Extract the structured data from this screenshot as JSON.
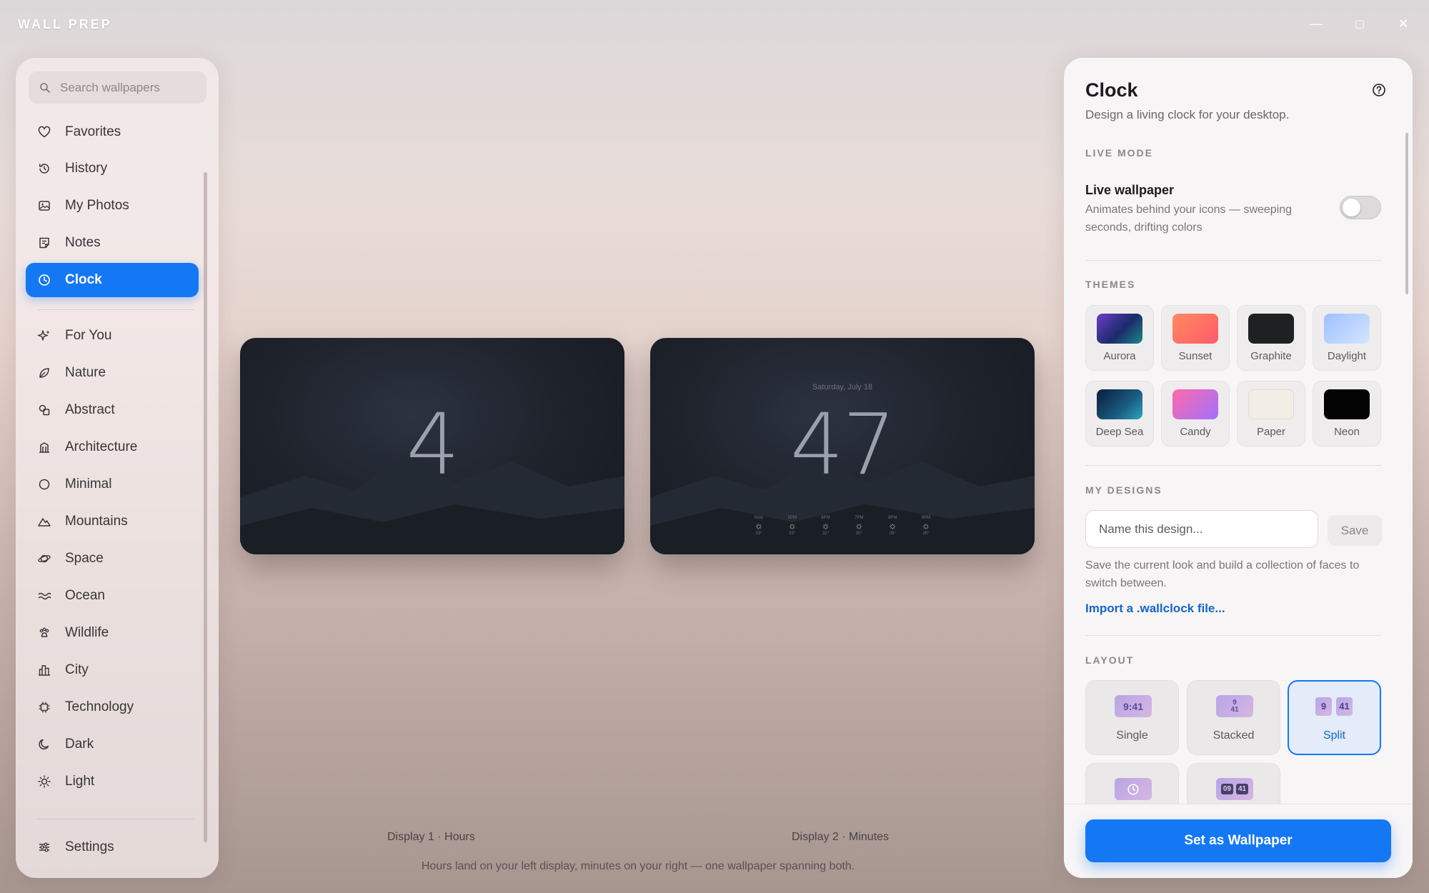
{
  "app": {
    "title": "WALL PREP"
  },
  "window_controls": {
    "minimize": "—",
    "maximize": "▢",
    "close": "✕"
  },
  "sidebar": {
    "search_placeholder": "Search wallpapers",
    "library": [
      {
        "label": "Favorites",
        "icon": "heart-icon"
      },
      {
        "label": "History",
        "icon": "history-icon"
      },
      {
        "label": "My Photos",
        "icon": "photo-icon"
      },
      {
        "label": "Notes",
        "icon": "note-icon"
      },
      {
        "label": "Clock",
        "icon": "clock-icon",
        "active": true
      }
    ],
    "categories": [
      {
        "label": "For You",
        "icon": "sparkle-icon"
      },
      {
        "label": "Nature",
        "icon": "leaf-icon"
      },
      {
        "label": "Abstract",
        "icon": "shapes-icon"
      },
      {
        "label": "Architecture",
        "icon": "building-icon"
      },
      {
        "label": "Minimal",
        "icon": "circle-icon"
      },
      {
        "label": "Mountains",
        "icon": "mountain-icon"
      },
      {
        "label": "Space",
        "icon": "planet-icon"
      },
      {
        "label": "Ocean",
        "icon": "waves-icon"
      },
      {
        "label": "Wildlife",
        "icon": "paw-icon"
      },
      {
        "label": "City",
        "icon": "city-icon"
      },
      {
        "label": "Technology",
        "icon": "chip-icon"
      },
      {
        "label": "Dark",
        "icon": "moon-icon"
      },
      {
        "label": "Light",
        "icon": "sun-icon"
      }
    ],
    "settings_label": "Settings"
  },
  "preview": {
    "display1": {
      "number": "4",
      "label": "Display 1 · Hours"
    },
    "display2": {
      "number": "47",
      "date": "Saturday, July 18",
      "label": "Display 2 · Minutes",
      "forecast": [
        {
          "time": "Now",
          "temp": "33°"
        },
        {
          "time": "5PM",
          "temp": "33°"
        },
        {
          "time": "6PM",
          "temp": "32°"
        },
        {
          "time": "7PM",
          "temp": "30°"
        },
        {
          "time": "8PM",
          "temp": "28°"
        },
        {
          "time": "9PM",
          "temp": "26°"
        }
      ]
    },
    "caption": "Hours land on your left display, minutes on your right — one wallpaper spanning both."
  },
  "panel": {
    "title": "Clock",
    "subtitle": "Design a living clock for your desktop.",
    "live_mode": {
      "heading": "LIVE MODE",
      "title": "Live wallpaper",
      "description": "Animates behind your icons — sweeping seconds, drifting colors",
      "enabled": false
    },
    "themes": {
      "heading": "THEMES",
      "items": [
        {
          "label": "Aurora",
          "colors": [
            "#2a1f6b",
            "#1a7a8a"
          ]
        },
        {
          "label": "Sunset",
          "colors": [
            "#ff7a5a",
            "#ff5a6e"
          ]
        },
        {
          "label": "Graphite",
          "colors": [
            "#1f2022",
            "#2a2b2e"
          ]
        },
        {
          "label": "Daylight",
          "colors": [
            "#a9c8ff",
            "#c9e0ff"
          ]
        },
        {
          "label": "Deep Sea",
          "colors": [
            "#0d2a4a",
            "#1f8fb0"
          ]
        },
        {
          "label": "Candy",
          "colors": [
            "#ff6fb3",
            "#9d6bff"
          ]
        },
        {
          "label": "Paper",
          "colors": [
            "#f3efe6",
            "#ece7dc"
          ]
        },
        {
          "label": "Neon",
          "colors": [
            "#000000",
            "#0a0a0a"
          ]
        }
      ]
    },
    "my_designs": {
      "heading": "MY DESIGNS",
      "input_placeholder": "Name this design...",
      "save_label": "Save",
      "description": "Save the current look and build a collection of faces to switch between.",
      "import_label": "Import a .wallclock file..."
    },
    "layout": {
      "heading": "LAYOUT",
      "items": [
        {
          "label": "Single",
          "preview": "9:41"
        },
        {
          "label": "Stacked",
          "preview_top": "9",
          "preview_bottom": "41"
        },
        {
          "label": "Split",
          "preview_left": "9",
          "preview_right": "41",
          "selected": true
        },
        {
          "label": "",
          "preview": "analog"
        },
        {
          "label": "",
          "preview_left": "09",
          "preview_right": "41"
        }
      ]
    },
    "cta_label": "Set as Wallpaper"
  },
  "colors": {
    "accent": "#1478f5",
    "link": "#1466c8"
  }
}
